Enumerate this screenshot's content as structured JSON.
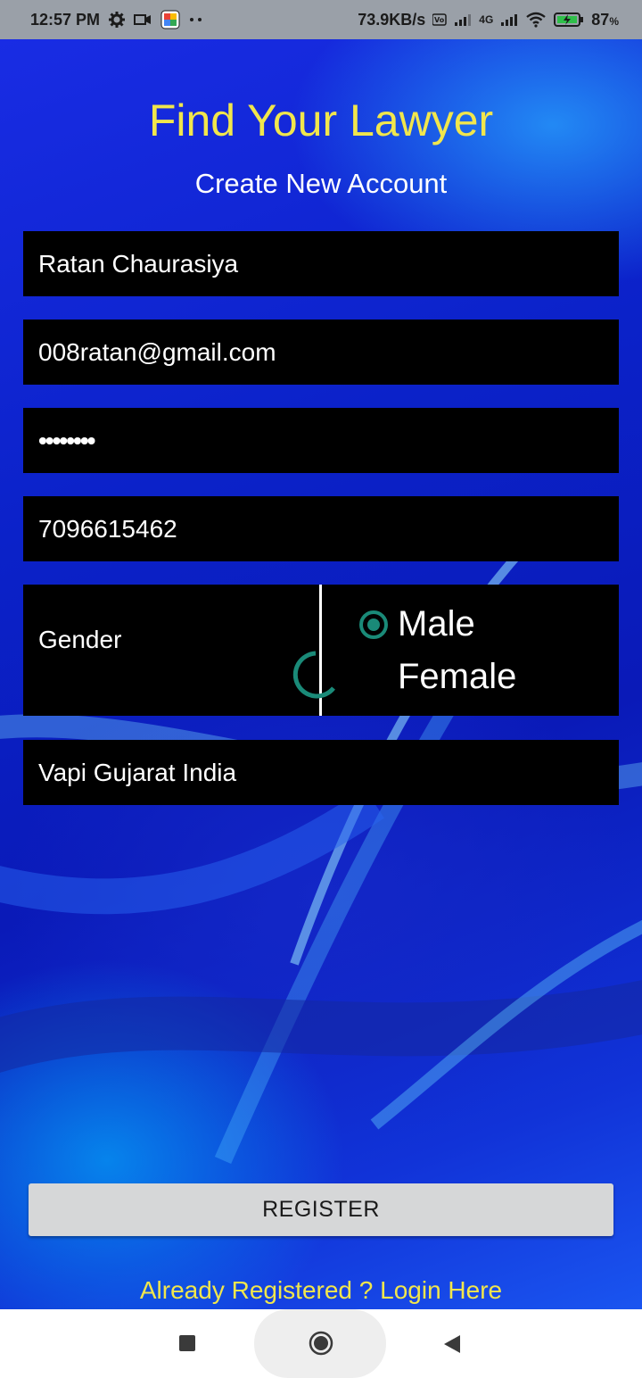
{
  "status_bar": {
    "time": "12:57 PM",
    "speed": "73.9KB/s",
    "battery": "87",
    "battery_unit": "%",
    "network": "4G"
  },
  "header": {
    "title": "Find Your Lawyer",
    "subtitle": "Create New Account"
  },
  "form": {
    "name_value": "Ratan Chaurasiya",
    "email_value": "008ratan@gmail.com",
    "password_value": "••••••••",
    "phone_value": "7096615462",
    "gender_label": "Gender",
    "gender_options": [
      "Male",
      "Female"
    ],
    "gender_selected": "Male",
    "address_value": "Vapi Gujarat India"
  },
  "actions": {
    "register_label": "REGISTER",
    "login_link": "Already Registered ? Login Here"
  },
  "colors": {
    "accent_yellow": "#f1e64c",
    "radio_teal": "#1a8a78",
    "field_bg": "#000000"
  },
  "icons": {
    "status_left": [
      "settings-icon",
      "video-icon",
      "photos-icon"
    ],
    "status_right": [
      "volte-icon",
      "signal-icon",
      "wifi-icon",
      "battery-charging-icon"
    ],
    "nav": [
      "recent-apps-icon",
      "home-icon",
      "back-icon"
    ]
  }
}
